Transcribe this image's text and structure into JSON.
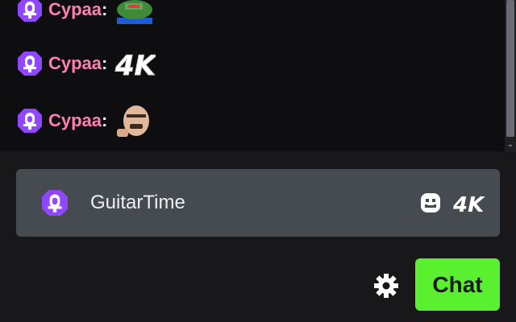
{
  "messages": [
    {
      "username": "Cypaa",
      "separator": ":",
      "badge_icon": "prime-badge-icon",
      "emote": "frog-emote-icon"
    },
    {
      "username": "Cypaa",
      "separator": ":",
      "badge_icon": "prime-badge-icon",
      "emote": "4k-emote-icon"
    },
    {
      "username": "Cypaa",
      "separator": ":",
      "badge_icon": "prime-badge-icon",
      "emote": "face-emote-icon"
    }
  ],
  "input": {
    "value": "GuitarTime",
    "badge_icon": "prime-badge-icon",
    "emote_picker_icon": "smiley-icon",
    "quick_emote_icon": "4k-emote-icon"
  },
  "footer": {
    "settings_icon": "gear-icon",
    "chat_button_label": "Chat"
  },
  "colors": {
    "username": "#ff7eb3",
    "badge": "#9147ff",
    "chat_button": "#5bf02f",
    "background": "#0e0e10",
    "input_background": "#464b51"
  }
}
